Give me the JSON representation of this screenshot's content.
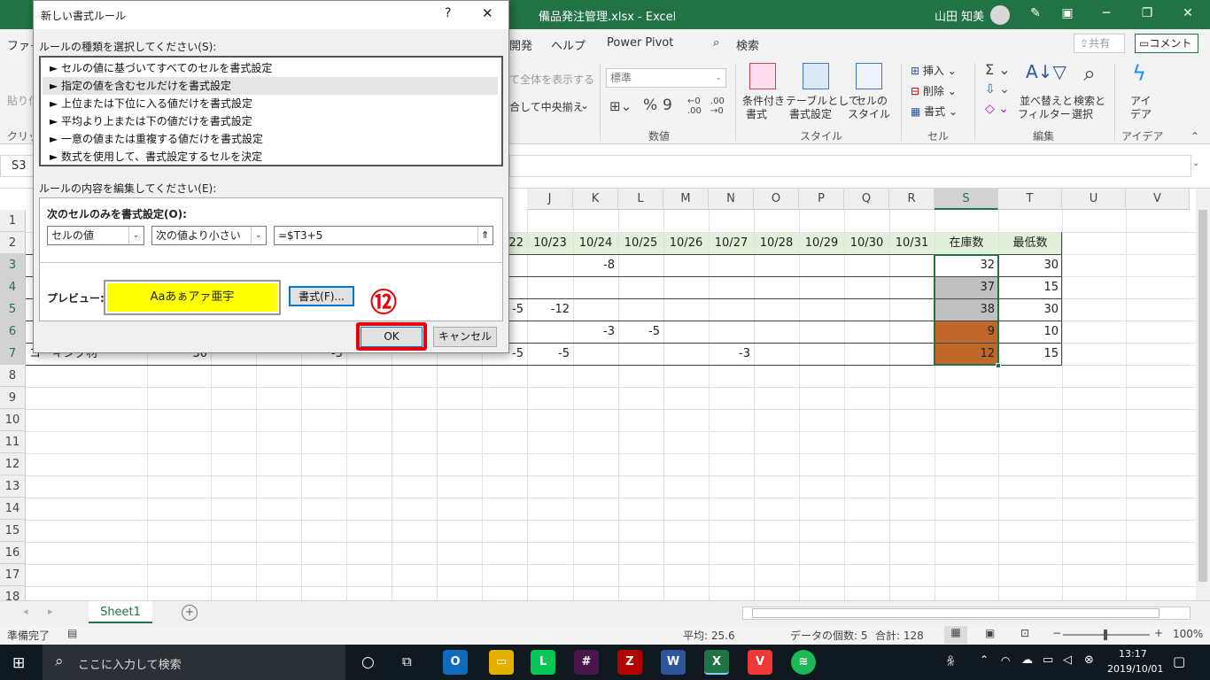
{
  "window": {
    "title": "備品発注管理.xlsx  -  Excel",
    "user": "山田 知美"
  },
  "menu": {
    "file": "ファイル",
    "dev": "開発",
    "help": "ヘルプ",
    "powerpivot": "Power Pivot",
    "search": "検索",
    "share": "共有",
    "comment": "コメント"
  },
  "ribbon": {
    "paste": "貼り付け",
    "clipboard": "クリップ",
    "wrap": "て全体を表示する",
    "merge": "合して中央揃え",
    "number_format": "標準",
    "number_group": "数値",
    "cond_format_l1": "条件付き",
    "cond_format_l2": "書式",
    "table_l1": "テーブルとして",
    "table_l2": "書式設定",
    "cellstyle_l1": "セルの",
    "cellstyle_l2": "スタイル",
    "style_group": "スタイル",
    "insert": "挿入",
    "delete": "削除",
    "format": "書式",
    "cells_group": "セル",
    "sort_l1": "並べ替えと",
    "sort_l2": "フィルター",
    "find_l1": "検索と",
    "find_l2": "選択",
    "edit_group": "編集",
    "ideas_l1": "アイ",
    "ideas_l2": "デア",
    "ideas_group": "アイデア"
  },
  "namebox": "S3",
  "columns": [
    "J",
    "K",
    "L",
    "M",
    "N",
    "O",
    "P",
    "Q",
    "R",
    "S",
    "T",
    "U",
    "V"
  ],
  "dates": [
    "22",
    "10/23",
    "10/24",
    "10/25",
    "10/26",
    "10/27",
    "10/28",
    "10/29",
    "10/30",
    "10/31"
  ],
  "headers": {
    "stock": "在庫数",
    "min": "最低数"
  },
  "rows": [
    "1",
    "2",
    "3",
    "4",
    "5",
    "6",
    "7",
    "8",
    "9",
    "10",
    "11",
    "12",
    "13",
    "14",
    "15",
    "16",
    "17",
    "18"
  ],
  "cells": {
    "k3": "-8",
    "s3": "32",
    "t3": "30",
    "s4": "37",
    "t4": "15",
    "i5": "-5",
    "j5": "-12",
    "s5": "38",
    "t5": "30",
    "k6": "-3",
    "l6": "-5",
    "s6": "9",
    "t6": "10",
    "a7": "コーキング材",
    "d7": "30",
    "g7": "-5",
    "i7": "-5",
    "j7": "-5",
    "n7": "-3",
    "s7": "12",
    "t7": "15"
  },
  "sheet": {
    "tab": "Sheet1"
  },
  "status": {
    "ready": "準備完了",
    "average": "平均: 25.6",
    "count": "データの個数: 5",
    "sum": "合計: 128",
    "zoom": "100%"
  },
  "taskbar": {
    "search_placeholder": "ここに入力して検索",
    "time": "13:17",
    "date": "2019/10/01"
  },
  "dialog": {
    "title": "新しい書式ルール",
    "help": "?",
    "rule_type_label": "ルールの種類を選択してください(S):",
    "rule_types": [
      "► セルの値に基づいてすべてのセルを書式設定",
      "► 指定の値を含むセルだけを書式設定",
      "► 上位または下位に入る値だけを書式設定",
      "► 平均より上または下の値だけを書式設定",
      "► 一意の値または重複する値だけを書式設定",
      "► 数式を使用して、書式設定するセルを決定"
    ],
    "edit_label": "ルールの内容を編集してください(E):",
    "format_only_label": "次のセルのみを書式設定(O):",
    "cond_type": "セルの値",
    "operator": "次の値より小さい",
    "formula": "=$T3+5",
    "preview_label": "プレビュー:",
    "preview_text": "Aaあぁアァ亜宇",
    "format_button": "書式(F)...",
    "ok": "OK",
    "cancel": "キャンセル",
    "step_marker": "⑫"
  },
  "colors": {
    "excel_green": "#217346",
    "preview_fill": "#ffff00",
    "gray_fill": "#c0c0c0",
    "orange_fill": "#c0682c",
    "header_fill": "#e2efda",
    "highlight_red": "#e8000b"
  }
}
